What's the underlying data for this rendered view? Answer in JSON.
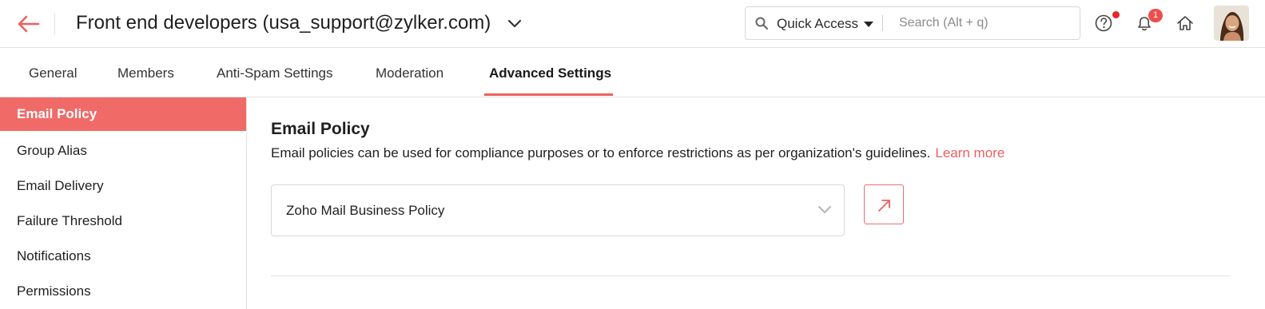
{
  "header": {
    "title": "Front end developers (usa_support@zylker.com)",
    "quick_access_label": "Quick Access",
    "search_placeholder": "Search (Alt + q)",
    "notification_count": "1",
    "accent_color": "#ee5f5f"
  },
  "tabs": [
    {
      "label": "General"
    },
    {
      "label": "Members"
    },
    {
      "label": "Anti-Spam Settings"
    },
    {
      "label": "Moderation"
    },
    {
      "label": "Advanced Settings",
      "active": true
    }
  ],
  "sidebar": {
    "items": [
      {
        "label": "Email Policy",
        "active": true
      },
      {
        "label": "Group Alias"
      },
      {
        "label": "Email Delivery"
      },
      {
        "label": "Failure Threshold"
      },
      {
        "label": "Notifications"
      },
      {
        "label": "Permissions"
      }
    ]
  },
  "main": {
    "title": "Email Policy",
    "description": "Email policies can be used for compliance purposes or to enforce restrictions as per organization's guidelines.",
    "learn_more": "Learn more",
    "policy_select_value": "Zoho Mail Business Policy"
  }
}
